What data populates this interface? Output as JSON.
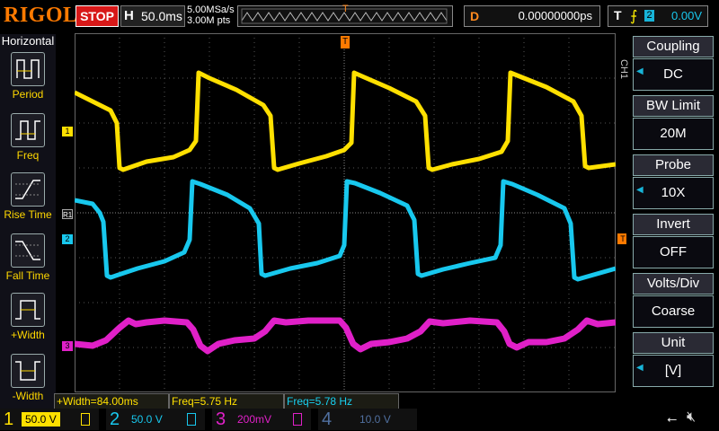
{
  "header": {
    "brand": "RIGOL",
    "run_state": "STOP",
    "horizontal_label": "H",
    "timebase": "50.0ms",
    "sample_rate": "5.00MSa/s",
    "memory_depth": "3.00M pts",
    "trigger_pos_marker": "T",
    "delay_label": "D",
    "delay_value": "0.00000000ps",
    "trigger_label": "T",
    "trigger_slope_symbol": "⨍",
    "trigger_source": "2",
    "trigger_level": "0.00V"
  },
  "left_menu": {
    "title": "Horizontal",
    "items": [
      {
        "label": "Period",
        "icon": "period-icon"
      },
      {
        "label": "Freq",
        "icon": "frequency-icon"
      },
      {
        "label": "Rise Time",
        "icon": "rise-time-icon"
      },
      {
        "label": "Fall Time",
        "icon": "fall-time-icon"
      },
      {
        "label": "+Width",
        "icon": "positive-width-icon"
      },
      {
        "label": "-Width",
        "icon": "negative-width-icon"
      }
    ]
  },
  "right_menu": {
    "channel_tag": "CH1",
    "items": [
      {
        "title": "Coupling",
        "value": "DC"
      },
      {
        "title": "BW Limit",
        "value": "20M"
      },
      {
        "title": "Probe",
        "value": "10X"
      },
      {
        "title": "Invert",
        "value": "OFF"
      },
      {
        "title": "Volts/Div",
        "value": "Coarse"
      },
      {
        "title": "Unit",
        "value": "[V]"
      }
    ]
  },
  "markers": {
    "ch1": "1",
    "ch2": "2",
    "ch3": "3",
    "r1": "R1",
    "trigger_level": "T"
  },
  "measurements": [
    {
      "text": "+Width=84.00ms",
      "color": "#ffe000"
    },
    {
      "text": "Freq=5.75 Hz",
      "color": "#ffe000"
    },
    {
      "text": "Freq=5.78 Hz",
      "color": "#18d0f0"
    }
  ],
  "channels": [
    {
      "num": "1",
      "scale": "50.0 V",
      "color": "#ffe000",
      "coupling_icon": "dc-coupling-icon"
    },
    {
      "num": "2",
      "scale": "50.0 V",
      "color": "#18c8ee",
      "coupling_icon": "dc-coupling-icon"
    },
    {
      "num": "3",
      "scale": "200mV",
      "color": "#e020c8",
      "coupling_icon": "ac-coupling-icon"
    },
    {
      "num": "4",
      "scale": "10.0 V",
      "color": "#5070a0",
      "coupling_icon": "dc-coupling-icon"
    }
  ],
  "status_icons": [
    "usb-icon",
    "speaker-muted-icon"
  ],
  "colors": {
    "ch1": "#ffe000",
    "ch2": "#18c8ee",
    "ch3": "#e020c8",
    "ch4": "#5070a0",
    "accent": "#ff7a00",
    "stop": "#d81818"
  }
}
